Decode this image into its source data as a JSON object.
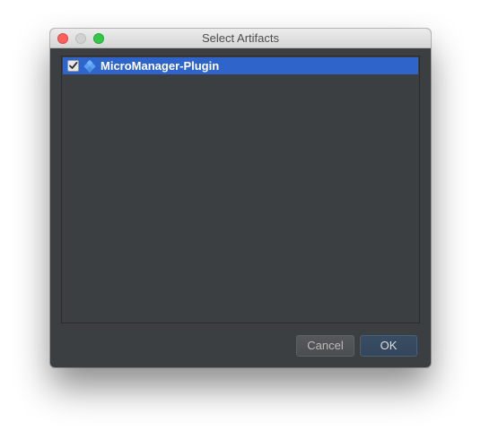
{
  "window": {
    "title": "Select Artifacts"
  },
  "artifacts": {
    "items": [
      {
        "label": "MicroManager-Plugin",
        "checked": true,
        "icon": "artifact-icon"
      }
    ]
  },
  "buttons": {
    "cancel_label": "Cancel",
    "ok_label": "OK"
  },
  "colors": {
    "background": "#3c3f41",
    "selection": "#2f65ca",
    "titlebar": "#e2e2e2",
    "close": "#fc605c",
    "zoom": "#34c84a",
    "default_button": "#394d63"
  }
}
